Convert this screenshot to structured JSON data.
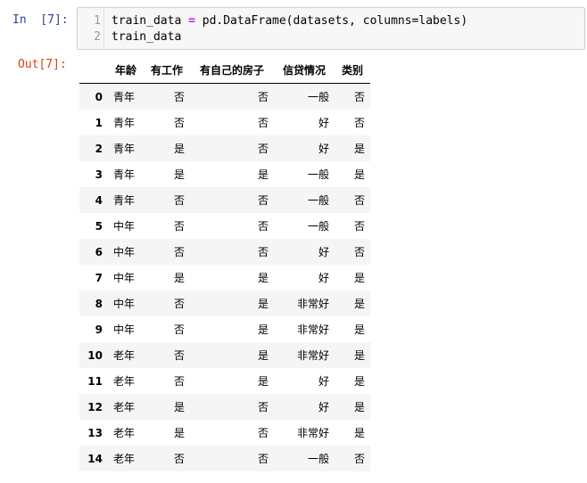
{
  "input_cell": {
    "prompt": "In  [7]:",
    "line_numbers": [
      "1",
      "2"
    ],
    "line1": {
      "pre": "train_data ",
      "op": "=",
      "post": " pd.DataFrame(datasets, columns=labels)"
    },
    "line2": "train_data"
  },
  "output_cell": {
    "prompt": "Out[7]:",
    "table": {
      "index_header": "",
      "columns": [
        "年龄",
        "有工作",
        "有自己的房子",
        "信贷情况",
        "类别"
      ],
      "rows": [
        {
          "index": "0",
          "cells": [
            "青年",
            "否",
            "否",
            "一般",
            "否"
          ]
        },
        {
          "index": "1",
          "cells": [
            "青年",
            "否",
            "否",
            "好",
            "否"
          ]
        },
        {
          "index": "2",
          "cells": [
            "青年",
            "是",
            "否",
            "好",
            "是"
          ]
        },
        {
          "index": "3",
          "cells": [
            "青年",
            "是",
            "是",
            "一般",
            "是"
          ]
        },
        {
          "index": "4",
          "cells": [
            "青年",
            "否",
            "否",
            "一般",
            "否"
          ]
        },
        {
          "index": "5",
          "cells": [
            "中年",
            "否",
            "否",
            "一般",
            "否"
          ]
        },
        {
          "index": "6",
          "cells": [
            "中年",
            "否",
            "否",
            "好",
            "否"
          ]
        },
        {
          "index": "7",
          "cells": [
            "中年",
            "是",
            "是",
            "好",
            "是"
          ]
        },
        {
          "index": "8",
          "cells": [
            "中年",
            "否",
            "是",
            "非常好",
            "是"
          ]
        },
        {
          "index": "9",
          "cells": [
            "中年",
            "否",
            "是",
            "非常好",
            "是"
          ]
        },
        {
          "index": "10",
          "cells": [
            "老年",
            "否",
            "是",
            "非常好",
            "是"
          ]
        },
        {
          "index": "11",
          "cells": [
            "老年",
            "否",
            "是",
            "好",
            "是"
          ]
        },
        {
          "index": "12",
          "cells": [
            "老年",
            "是",
            "否",
            "好",
            "是"
          ]
        },
        {
          "index": "13",
          "cells": [
            "老年",
            "是",
            "否",
            "非常好",
            "是"
          ]
        },
        {
          "index": "14",
          "cells": [
            "老年",
            "否",
            "否",
            "一般",
            "否"
          ]
        }
      ]
    }
  },
  "colors": {
    "in_prompt": "#303f9f",
    "out_prompt": "#d84315",
    "operator": "#aa22ff"
  }
}
